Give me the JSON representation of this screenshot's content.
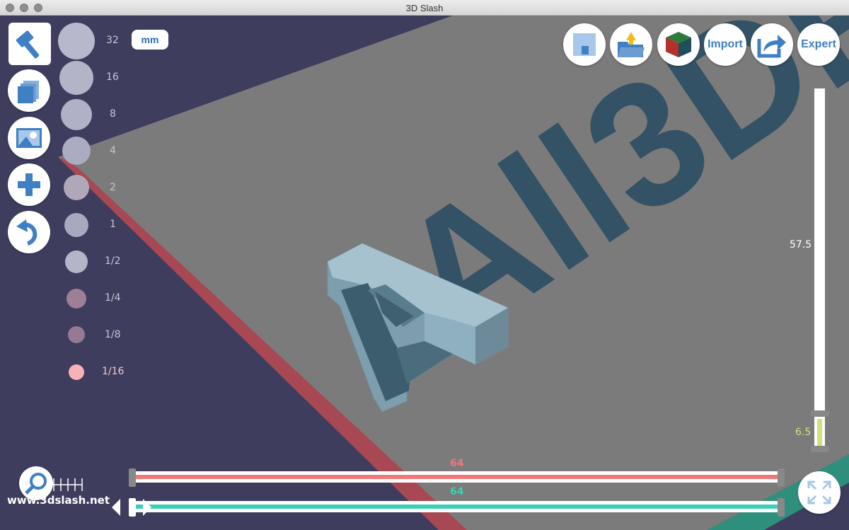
{
  "window": {
    "title": "3D Slash"
  },
  "scene": {
    "background_text": "All3DP"
  },
  "tools": {
    "hammer": "hammer-icon",
    "cube_layers": "layers-icon",
    "picture": "image-icon",
    "add": "plus-icon",
    "undo": "undo-icon"
  },
  "sizes": {
    "unit": "mm",
    "items": [
      {
        "label": "32",
        "color": "#b8b8cc"
      },
      {
        "label": "16",
        "color": "#b4b4c8"
      },
      {
        "label": "8",
        "color": "#b0b0c6"
      },
      {
        "label": "4",
        "color": "#ababc2"
      },
      {
        "label": "2",
        "color": "#b0a8b8"
      },
      {
        "label": "1",
        "color": "#a8a8bf"
      },
      {
        "label": "1/2",
        "color": "#b5b5c8"
      },
      {
        "label": "1/4",
        "color": "#9e7f95"
      },
      {
        "label": "1/8",
        "color": "#957a92"
      },
      {
        "label": "1/16",
        "color": "#f7b2b7"
      }
    ]
  },
  "toolbar": {
    "save": "save-icon",
    "open": "open-folder-icon",
    "color": "color-cube-icon",
    "import_label": "Import",
    "export": "export-icon",
    "expert_label": "Expert"
  },
  "zslider": {
    "top_value": "57.5",
    "bottom_value": "6.5",
    "top_color": "#ffffff",
    "bottom_color": "#d4e07a"
  },
  "xslider": {
    "value": "64",
    "color": "#f07878"
  },
  "yslider": {
    "value": "64",
    "color": "#3ccfb4"
  },
  "footer": {
    "website": "www.3dslash.net"
  }
}
